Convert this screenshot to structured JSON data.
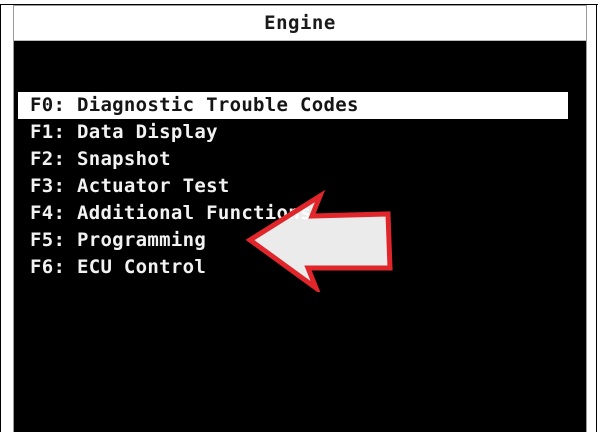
{
  "screen": {
    "title": "Engine"
  },
  "menu": {
    "items": [
      {
        "key": "F0:",
        "label": "Diagnostic Trouble Codes",
        "selected": true
      },
      {
        "key": "F1:",
        "label": "Data Display",
        "selected": false
      },
      {
        "key": "F2:",
        "label": "Snapshot",
        "selected": false
      },
      {
        "key": "F3:",
        "label": "Actuator Test",
        "selected": false
      },
      {
        "key": "F4:",
        "label": "Additional Functions",
        "selected": false
      },
      {
        "key": "F5:",
        "label": "Programming",
        "selected": false
      },
      {
        "key": "F6:",
        "label": "ECU Control",
        "selected": false
      }
    ]
  },
  "annotation": {
    "icon": "left-pointing-arrow-icon",
    "color": "#e0262b",
    "target_item": "F5: Programming"
  },
  "colors": {
    "screen_background": "#000000",
    "text": "#f2f2f2",
    "highlight_background": "#ffffff",
    "highlight_text": "#151515",
    "title_background": "#ffffff"
  }
}
